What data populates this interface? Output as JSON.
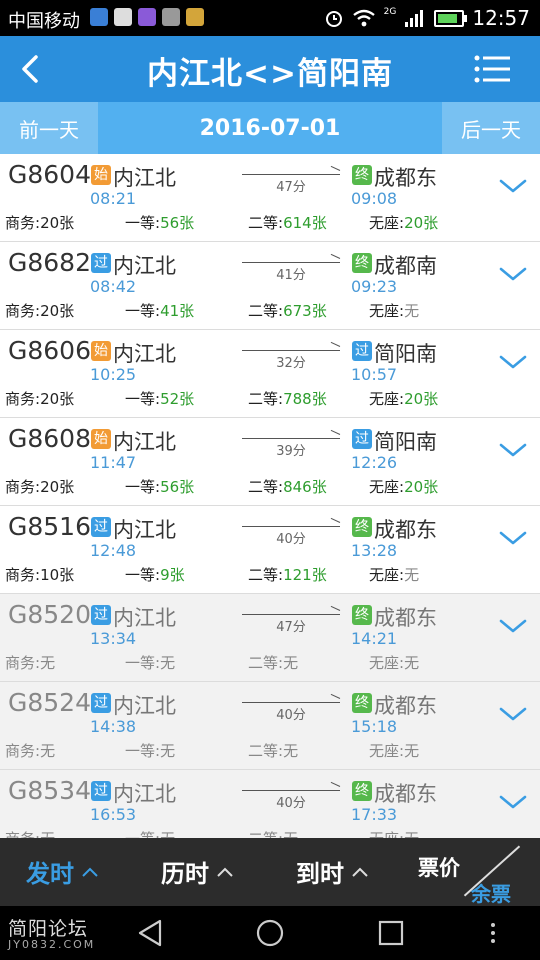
{
  "status_bar": {
    "carrier": "中国移动",
    "network": "2G",
    "time": "12:57"
  },
  "header": {
    "title": "内江北<>简阳南",
    "back_icon": "back-arrow-icon",
    "menu_icon": "menu-list-icon"
  },
  "date_bar": {
    "prev_label": "前一天",
    "date": "2016-07-01",
    "next_label": "后一天"
  },
  "seat_labels": {
    "business": "商务:",
    "first": "一等:",
    "second": "二等:",
    "standing": "无座:"
  },
  "trains": [
    {
      "number": "G8604",
      "from_badge": "始",
      "from_station": "内江北",
      "dep_time": "08:21",
      "duration": "47分",
      "to_badge": "终",
      "to_station": "成都东",
      "arr_time": "09:08",
      "business": "20张",
      "first": "56张",
      "second": "614张",
      "standing": "20张",
      "dimmed": false
    },
    {
      "number": "G8682",
      "from_badge": "过",
      "from_station": "内江北",
      "dep_time": "08:42",
      "duration": "41分",
      "to_badge": "终",
      "to_station": "成都南",
      "arr_time": "09:23",
      "business": "20张",
      "first": "41张",
      "second": "673张",
      "standing": "无",
      "dimmed": false
    },
    {
      "number": "G8606",
      "from_badge": "始",
      "from_station": "内江北",
      "dep_time": "10:25",
      "duration": "32分",
      "to_badge": "过",
      "to_station": "简阳南",
      "arr_time": "10:57",
      "business": "20张",
      "first": "52张",
      "second": "788张",
      "standing": "20张",
      "dimmed": false
    },
    {
      "number": "G8608",
      "from_badge": "始",
      "from_station": "内江北",
      "dep_time": "11:47",
      "duration": "39分",
      "to_badge": "过",
      "to_station": "简阳南",
      "arr_time": "12:26",
      "business": "20张",
      "first": "56张",
      "second": "846张",
      "standing": "20张",
      "dimmed": false
    },
    {
      "number": "G8516",
      "from_badge": "过",
      "from_station": "内江北",
      "dep_time": "12:48",
      "duration": "40分",
      "to_badge": "终",
      "to_station": "成都东",
      "arr_time": "13:28",
      "business": "10张",
      "first": "9张",
      "second": "121张",
      "standing": "无",
      "dimmed": false
    },
    {
      "number": "G8520",
      "from_badge": "过",
      "from_station": "内江北",
      "dep_time": "13:34",
      "duration": "47分",
      "to_badge": "终",
      "to_station": "成都东",
      "arr_time": "14:21",
      "business": "无",
      "first": "无",
      "second": "无",
      "standing": "无",
      "dimmed": true
    },
    {
      "number": "G8524",
      "from_badge": "过",
      "from_station": "内江北",
      "dep_time": "14:38",
      "duration": "40分",
      "to_badge": "终",
      "to_station": "成都东",
      "arr_time": "15:18",
      "business": "无",
      "first": "无",
      "second": "无",
      "standing": "无",
      "dimmed": true
    },
    {
      "number": "G8534",
      "from_badge": "过",
      "from_station": "内江北",
      "dep_time": "16:53",
      "duration": "40分",
      "to_badge": "终",
      "to_station": "成都东",
      "arr_time": "17:33",
      "business": "无",
      "first": "无",
      "second": "无",
      "standing": "无",
      "dimmed": true
    }
  ],
  "sort_bar": {
    "depart": "发时",
    "duration": "历时",
    "arrive": "到时",
    "price": "票价",
    "remaining": "余票"
  },
  "watermark": {
    "line1": "简阳论坛",
    "line2": "JY0832.COM"
  },
  "colors": {
    "header": "#2b8fdc",
    "date_bar": "#52b0f0",
    "accent_blue": "#3a9de3",
    "seats_green": "#2e9d2e",
    "badge_start": "#f29b35",
    "badge_end": "#56b84c"
  }
}
